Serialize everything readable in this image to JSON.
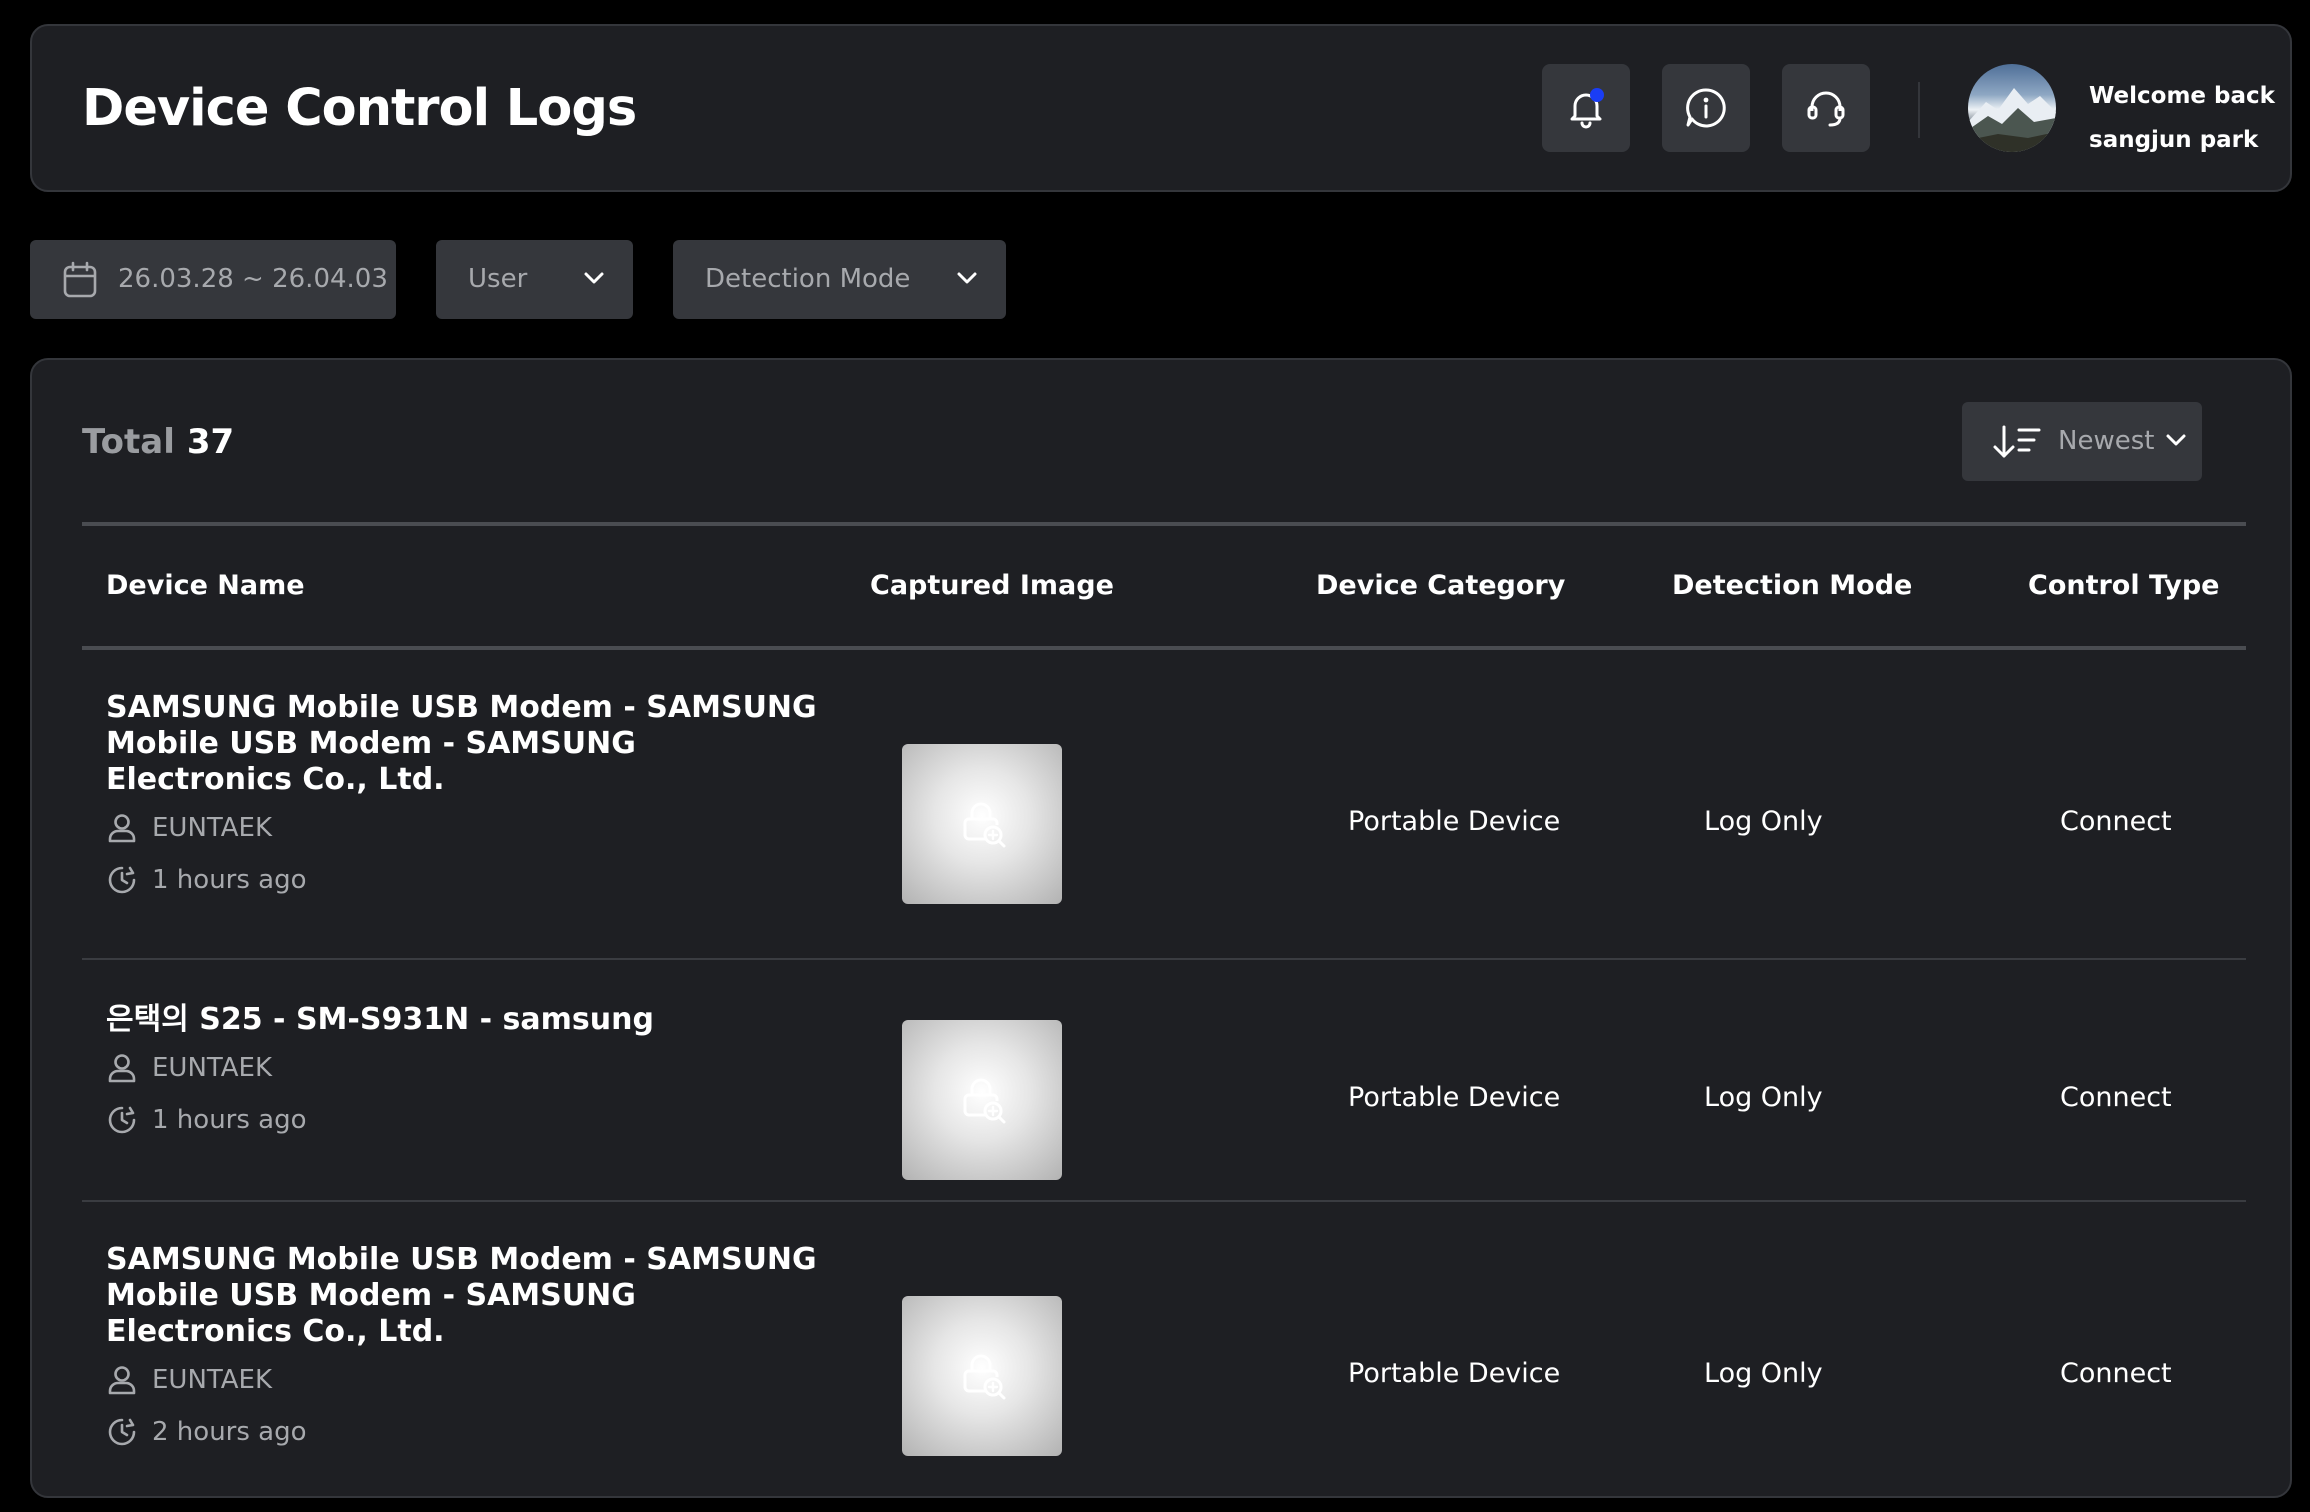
{
  "header": {
    "title": "Device Control Logs",
    "welcome_label": "Welcome back",
    "user_name": "sangjun park",
    "notification_dot_color": "#1a3df5"
  },
  "filters": {
    "date_range": "26.03.28 ~ 26.04.03",
    "user": "User",
    "detection_mode": "Detection Mode"
  },
  "list": {
    "total_label": "Total",
    "total_count": "37",
    "sort_label": "Newest",
    "columns": [
      "Device Name",
      "Captured Image",
      "Device Category",
      "Detection Mode",
      "Control Type"
    ],
    "rows": [
      {
        "device_name": "SAMSUNG Mobile USB Modem - SAMSUNG Mobile USB Modem - SAMSUNG Electronics Co., Ltd.",
        "user": "EUNTAEK",
        "time": "1 hours ago",
        "category": "Portable Device",
        "detection_mode": "Log Only",
        "control_type": "Connect"
      },
      {
        "device_name": "은택의 S25 - SM-S931N - samsung",
        "user": "EUNTAEK",
        "time": "1 hours ago",
        "category": "Portable Device",
        "detection_mode": "Log Only",
        "control_type": "Connect"
      },
      {
        "device_name": "SAMSUNG Mobile USB Modem - SAMSUNG Mobile USB Modem - SAMSUNG Electronics Co., Ltd.",
        "user": "EUNTAEK",
        "time": "2 hours ago",
        "category": "Portable Device",
        "detection_mode": "Log Only",
        "control_type": "Connect"
      }
    ]
  }
}
